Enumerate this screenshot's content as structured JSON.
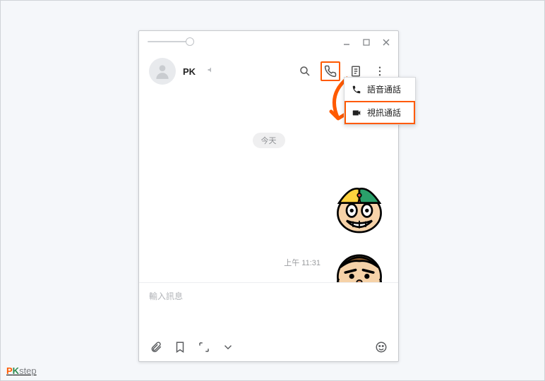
{
  "window": {
    "minimize": "minimize",
    "maximize": "maximize",
    "close": "close"
  },
  "header": {
    "contact_name": "PK"
  },
  "dropdown": {
    "voice_call": "語音通話",
    "video_call": "視訊通話"
  },
  "messages": {
    "date_label": "今天",
    "timestamp": "上午 11:31"
  },
  "input": {
    "placeholder": "輸入訊息"
  },
  "watermark": {
    "p": "P",
    "k": "K",
    "suffix": "step"
  }
}
